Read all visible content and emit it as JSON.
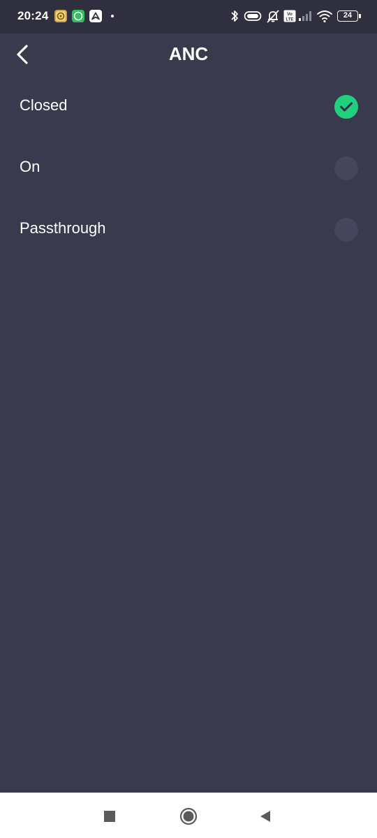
{
  "status_bar": {
    "time": "20:24",
    "battery_level": "24",
    "icons": [
      "shield-app-icon",
      "whatsapp-icon",
      "navigation-app-icon",
      "notification-dot",
      "bluetooth-icon",
      "earbuds-icon",
      "alarm-off-icon",
      "volte-icon",
      "signal-icon",
      "wifi-icon",
      "battery-icon"
    ]
  },
  "header": {
    "title": "ANC",
    "back_icon": "chevron-left-icon"
  },
  "options": [
    {
      "label": "Closed",
      "selected": true
    },
    {
      "label": "On",
      "selected": false
    },
    {
      "label": "Passthrough",
      "selected": false
    }
  ],
  "colors": {
    "background": "#3a3a4e",
    "status_bar": "#2f2f3f",
    "selected": "#21d07f",
    "unselected": "#45455b",
    "nav_bar": "#ffffff"
  },
  "nav_bar": {
    "icons": [
      "recents-square-icon",
      "home-circle-icon",
      "back-triangle-icon"
    ]
  }
}
